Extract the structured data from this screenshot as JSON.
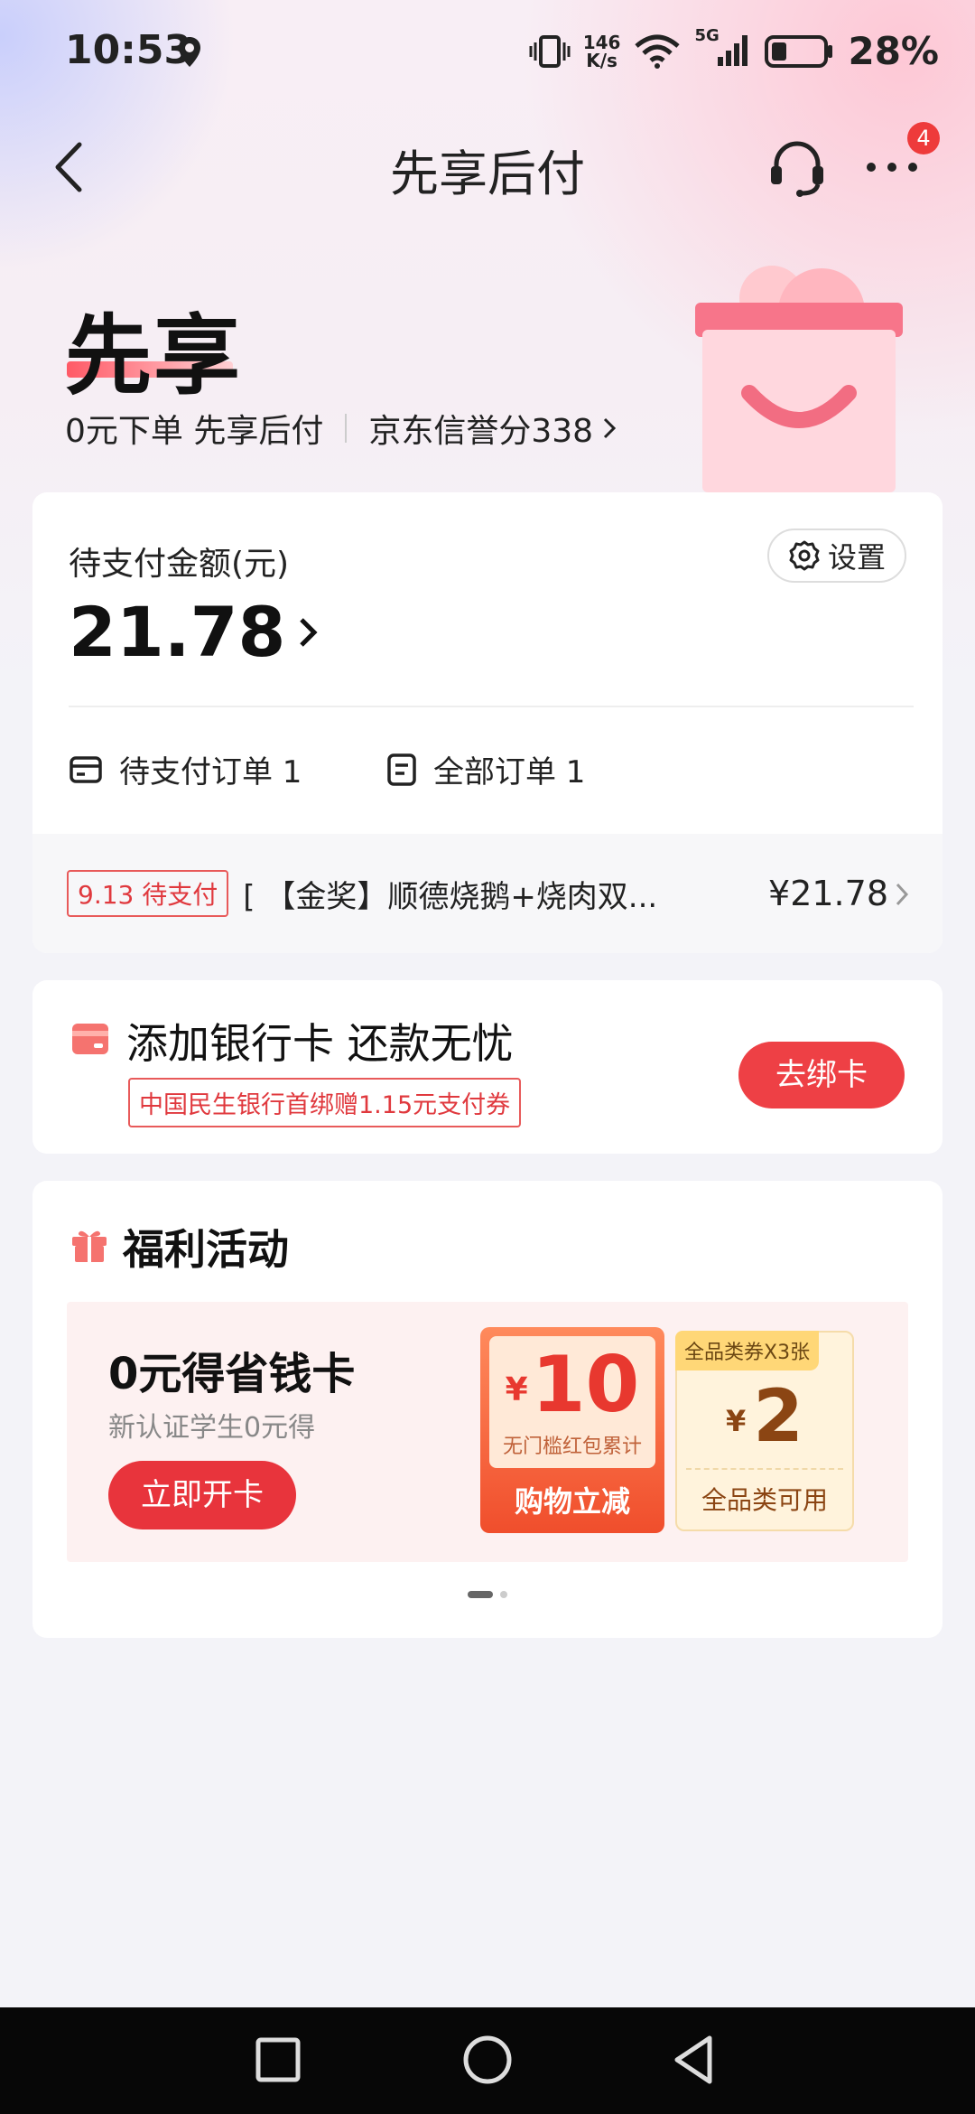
{
  "status_bar": {
    "time": "10:53",
    "net_speed_value": "146",
    "net_speed_unit": "K/s",
    "network": "5G",
    "battery": "28%"
  },
  "nav": {
    "title": "先享后付",
    "badge_count": "4"
  },
  "hero": {
    "title": "先享",
    "slogan": "0元下单 先享后付",
    "credit_score": "京东信誉分338"
  },
  "payment": {
    "label": "待支付金额(元)",
    "amount": "21.78",
    "settings_label": "设置",
    "pending_orders": "待支付订单 1",
    "all_orders": "全部订单 1",
    "order": {
      "date_tag": "9.13 待支付",
      "name": "[ 【金奖】顺德烧鹅+烧肉双...",
      "price": "¥21.78"
    }
  },
  "bank": {
    "title": "添加银行卡 还款无忧",
    "promo": "中国民生银行首绑赠1.15元支付券",
    "button": "去绑卡"
  },
  "welfare": {
    "title": "福利活动",
    "promo_title": "0元得省钱卡",
    "promo_sub": "新认证学生0元得",
    "open_button": "立即开卡",
    "coupon1": {
      "currency": "¥",
      "amount": "10",
      "desc": "无门槛红包累计",
      "footer": "购物立减"
    },
    "coupon2": {
      "tag": "全品类券X3张",
      "currency": "¥",
      "amount": "2",
      "footer": "全品类可用"
    }
  },
  "colors": {
    "accent_red": "#ee4045",
    "page_bg": "#f3f3f8"
  }
}
